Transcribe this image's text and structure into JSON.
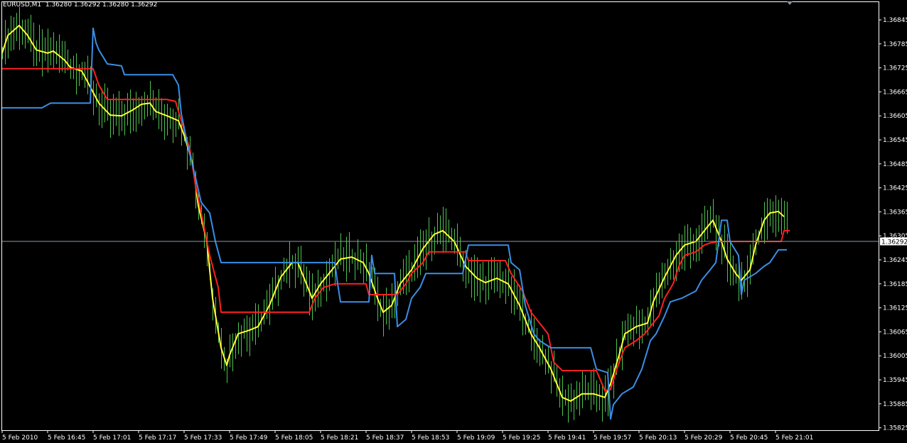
{
  "header": {
    "symbol": "EURUSD,M1",
    "open": "1.36280",
    "high": "1.36292",
    "low": "1.36280",
    "close": "1.36292"
  },
  "chart_data": {
    "type": "line",
    "title": "EURUSD,M1",
    "current_price": "1.36292",
    "ylim": [
      1.35815,
      1.36895
    ],
    "xlim_minutes": [
      0,
      308
    ],
    "grid": false,
    "colors": {
      "background": "#000000",
      "bars": "#4ec34e",
      "ma_fast": "#ffff33",
      "ma_mid": "#ff2020",
      "channel": "#3a8ee6",
      "axis": "#ffffff",
      "price_line": "#8a99a8"
    },
    "y_ticks": [
      "1.36845",
      "1.36785",
      "1.36725",
      "1.36665",
      "1.36605",
      "1.36545",
      "1.36485",
      "1.36425",
      "1.36365",
      "1.36305",
      "1.36245",
      "1.36185",
      "1.36125",
      "1.36065",
      "1.36005",
      "1.35945",
      "1.35885",
      "1.35825"
    ],
    "x_ticks": [
      {
        "m": 0,
        "label": "5 Feb 2010"
      },
      {
        "m": 16,
        "label": "5 Feb 16:45"
      },
      {
        "m": 32,
        "label": "5 Feb 17:01"
      },
      {
        "m": 48,
        "label": "5 Feb 17:17"
      },
      {
        "m": 64,
        "label": "5 Feb 17:33"
      },
      {
        "m": 80,
        "label": "5 Feb 17:49"
      },
      {
        "m": 96,
        "label": "5 Feb 18:05"
      },
      {
        "m": 112,
        "label": "5 Feb 18:21"
      },
      {
        "m": 128,
        "label": "5 Feb 18:37"
      },
      {
        "m": 144,
        "label": "5 Feb 18:53"
      },
      {
        "m": 160,
        "label": "5 Feb 19:09"
      },
      {
        "m": 176,
        "label": "5 Feb 19:25"
      },
      {
        "m": 192,
        "label": "5 Feb 19:41"
      },
      {
        "m": 208,
        "label": "5 Feb 19:57"
      },
      {
        "m": 224,
        "label": "5 Feb 20:13"
      },
      {
        "m": 240,
        "label": "5 Feb 20:29"
      },
      {
        "m": 256,
        "label": "5 Feb 20:45"
      },
      {
        "m": 272,
        "label": "5 Feb 21:01"
      }
    ],
    "series": [
      {
        "name": "yellow-ma",
        "color": "#ffff33",
        "points": [
          [
            0,
            1.36762
          ],
          [
            2,
            1.36806
          ],
          [
            6,
            1.36831
          ],
          [
            9,
            1.36806
          ],
          [
            12,
            1.3677
          ],
          [
            16,
            1.36762
          ],
          [
            18,
            1.36767
          ],
          [
            22,
            1.36744
          ],
          [
            24,
            1.36726
          ],
          [
            28,
            1.36717
          ],
          [
            30,
            1.36691
          ],
          [
            34,
            1.36637
          ],
          [
            38,
            1.36607
          ],
          [
            42,
            1.36605
          ],
          [
            46,
            1.3662
          ],
          [
            49,
            1.36634
          ],
          [
            52,
            1.36637
          ],
          [
            54,
            1.36616
          ],
          [
            58,
            1.36605
          ],
          [
            62,
            1.36593
          ],
          [
            64,
            1.36557
          ],
          [
            67,
            1.36486
          ],
          [
            69,
            1.3638
          ],
          [
            72,
            1.36291
          ],
          [
            74,
            1.36149
          ],
          [
            77,
            1.36025
          ],
          [
            79,
            1.35981
          ],
          [
            80,
            1.36007
          ],
          [
            83,
            1.3606
          ],
          [
            87,
            1.36069
          ],
          [
            90,
            1.36078
          ],
          [
            94,
            1.36131
          ],
          [
            98,
            1.36202
          ],
          [
            102,
            1.36238
          ],
          [
            104,
            1.36238
          ],
          [
            107,
            1.36185
          ],
          [
            109,
            1.36149
          ],
          [
            112,
            1.36185
          ],
          [
            116,
            1.3622
          ],
          [
            119,
            1.36247
          ],
          [
            123,
            1.36252
          ],
          [
            127,
            1.36238
          ],
          [
            129,
            1.36211
          ],
          [
            132,
            1.36149
          ],
          [
            134,
            1.36114
          ],
          [
            137,
            1.36131
          ],
          [
            140,
            1.36185
          ],
          [
            144,
            1.3622
          ],
          [
            148,
            1.36273
          ],
          [
            152,
            1.36309
          ],
          [
            155,
            1.36318
          ],
          [
            159,
            1.36291
          ],
          [
            163,
            1.36229
          ],
          [
            167,
            1.36199
          ],
          [
            170,
            1.36188
          ],
          [
            174,
            1.36199
          ],
          [
            178,
            1.36185
          ],
          [
            182,
            1.36131
          ],
          [
            186,
            1.3606
          ],
          [
            189,
            1.36025
          ],
          [
            193,
            1.35972
          ],
          [
            197,
            1.35901
          ],
          [
            200,
            1.35892
          ],
          [
            204,
            1.3591
          ],
          [
            208,
            1.3591
          ],
          [
            212,
            1.35901
          ],
          [
            214,
            1.35936
          ],
          [
            217,
            1.36007
          ],
          [
            219,
            1.3606
          ],
          [
            223,
            1.36078
          ],
          [
            227,
            1.36087
          ],
          [
            229,
            1.3614
          ],
          [
            233,
            1.36202
          ],
          [
            237,
            1.36256
          ],
          [
            240,
            1.36282
          ],
          [
            244,
            1.36291
          ],
          [
            248,
            1.36327
          ],
          [
            250,
            1.36344
          ],
          [
            253,
            1.36291
          ],
          [
            255,
            1.36247
          ],
          [
            258,
            1.36211
          ],
          [
            260,
            1.36194
          ],
          [
            263,
            1.3622
          ],
          [
            265,
            1.36282
          ],
          [
            268,
            1.36344
          ],
          [
            270,
            1.36362
          ],
          [
            273,
            1.36366
          ],
          [
            275,
            1.36353
          ]
        ]
      },
      {
        "name": "red-line",
        "color": "#ff2020",
        "points": [
          [
            0,
            1.36723
          ],
          [
            32,
            1.36723
          ],
          [
            34,
            1.36682
          ],
          [
            37,
            1.36646
          ],
          [
            58,
            1.36646
          ],
          [
            61,
            1.36641
          ],
          [
            63,
            1.36593
          ],
          [
            66,
            1.36522
          ],
          [
            68,
            1.36433
          ],
          [
            71,
            1.36327
          ],
          [
            73,
            1.36256
          ],
          [
            76,
            1.36176
          ],
          [
            77,
            1.36114
          ],
          [
            108,
            1.36114
          ],
          [
            110,
            1.36149
          ],
          [
            113,
            1.36176
          ],
          [
            117,
            1.36185
          ],
          [
            128,
            1.36185
          ],
          [
            129,
            1.36158
          ],
          [
            139,
            1.36158
          ],
          [
            142,
            1.36185
          ],
          [
            144,
            1.36211
          ],
          [
            148,
            1.36238
          ],
          [
            150,
            1.36265
          ],
          [
            163,
            1.36265
          ],
          [
            164,
            1.36243
          ],
          [
            177,
            1.36243
          ],
          [
            179,
            1.36211
          ],
          [
            183,
            1.36167
          ],
          [
            186,
            1.36114
          ],
          [
            189,
            1.36087
          ],
          [
            192,
            1.3606
          ],
          [
            194,
            1.35989
          ],
          [
            197,
            1.35968
          ],
          [
            209,
            1.35968
          ],
          [
            212,
            1.35918
          ],
          [
            214,
            1.35922
          ],
          [
            217,
            1.35989
          ],
          [
            219,
            1.36025
          ],
          [
            223,
            1.36043
          ],
          [
            226,
            1.3606
          ],
          [
            228,
            1.36078
          ],
          [
            231,
            1.36105
          ],
          [
            233,
            1.36149
          ],
          [
            236,
            1.36185
          ],
          [
            238,
            1.36229
          ],
          [
            240,
            1.36256
          ],
          [
            244,
            1.36265
          ],
          [
            247,
            1.36282
          ],
          [
            249,
            1.36287
          ],
          [
            252,
            1.36291
          ],
          [
            274,
            1.36291
          ],
          [
            275,
            1.36318
          ],
          [
            277,
            1.36318
          ]
        ]
      },
      {
        "name": "blue-line",
        "color": "#3a8ee6",
        "points": [
          [
            0,
            1.36625
          ],
          [
            14,
            1.36625
          ],
          [
            17,
            1.36637
          ],
          [
            31,
            1.36637
          ],
          [
            32,
            1.36824
          ],
          [
            33,
            1.36788
          ],
          [
            34,
            1.3677
          ],
          [
            37,
            1.36735
          ],
          [
            42,
            1.3673
          ],
          [
            43,
            1.36708
          ],
          [
            60,
            1.36708
          ],
          [
            62,
            1.36682
          ],
          [
            63,
            1.36611
          ],
          [
            65,
            1.3654
          ],
          [
            68,
            1.36451
          ],
          [
            70,
            1.36389
          ],
          [
            73,
            1.36362
          ],
          [
            75,
            1.36291
          ],
          [
            77,
            1.36238
          ],
          [
            117,
            1.36238
          ],
          [
            118,
            1.36185
          ],
          [
            119,
            1.3614
          ],
          [
            129,
            1.3614
          ],
          [
            130,
            1.36256
          ],
          [
            131,
            1.36211
          ],
          [
            138,
            1.36211
          ],
          [
            139,
            1.36078
          ],
          [
            142,
            1.36096
          ],
          [
            144,
            1.36149
          ],
          [
            147,
            1.36176
          ],
          [
            149,
            1.36211
          ],
          [
            162,
            1.36211
          ],
          [
            164,
            1.36282
          ],
          [
            178,
            1.36282
          ],
          [
            179,
            1.36238
          ],
          [
            182,
            1.3622
          ],
          [
            184,
            1.36131
          ],
          [
            187,
            1.3606
          ],
          [
            189,
            1.36043
          ],
          [
            193,
            1.36025
          ],
          [
            207,
            1.36025
          ],
          [
            209,
            1.35972
          ],
          [
            213,
            1.35963
          ],
          [
            214,
            1.35847
          ],
          [
            215,
            1.35883
          ],
          [
            218,
            1.3591
          ],
          [
            222,
            1.35927
          ],
          [
            225,
            1.35972
          ],
          [
            228,
            1.36043
          ],
          [
            230,
            1.3606
          ],
          [
            233,
            1.36105
          ],
          [
            235,
            1.3614
          ],
          [
            239,
            1.36149
          ],
          [
            244,
            1.36167
          ],
          [
            246,
            1.36194
          ],
          [
            249,
            1.3622
          ],
          [
            251,
            1.36238
          ],
          [
            253,
            1.36344
          ],
          [
            255,
            1.36344
          ],
          [
            256,
            1.36291
          ],
          [
            259,
            1.36256
          ],
          [
            260,
            1.36158
          ],
          [
            261,
            1.36194
          ],
          [
            265,
            1.36211
          ],
          [
            268,
            1.36229
          ],
          [
            270,
            1.36238
          ],
          [
            273,
            1.3627
          ],
          [
            276,
            1.3627
          ]
        ]
      }
    ]
  }
}
